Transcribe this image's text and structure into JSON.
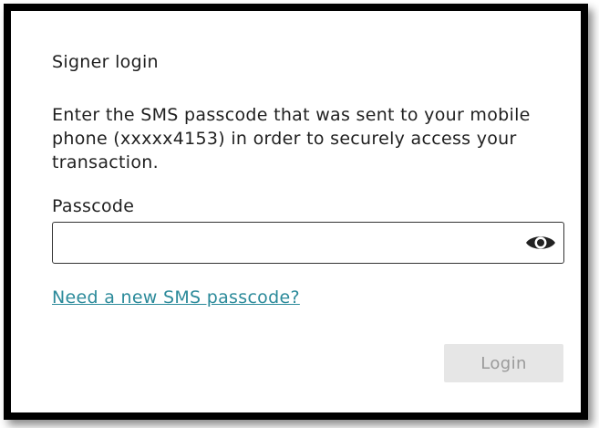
{
  "dialog": {
    "title": "Signer login",
    "instructions": "Enter the SMS passcode that was sent to your mobile phone (xxxxx4153) in order to securely access your transaction.",
    "passcode_label": "Passcode",
    "passcode_value": "",
    "passcode_placeholder": "",
    "visibility_icon": "eye-icon",
    "new_passcode_link": "Need a new SMS passcode?",
    "login_label": "Login",
    "login_enabled": false
  },
  "colors": {
    "text": "#1f1f1f",
    "link": "#2b8a9a",
    "button_disabled_bg": "#e6e6e6",
    "button_disabled_text": "#9a9a9a",
    "frame_border": "#000000"
  }
}
